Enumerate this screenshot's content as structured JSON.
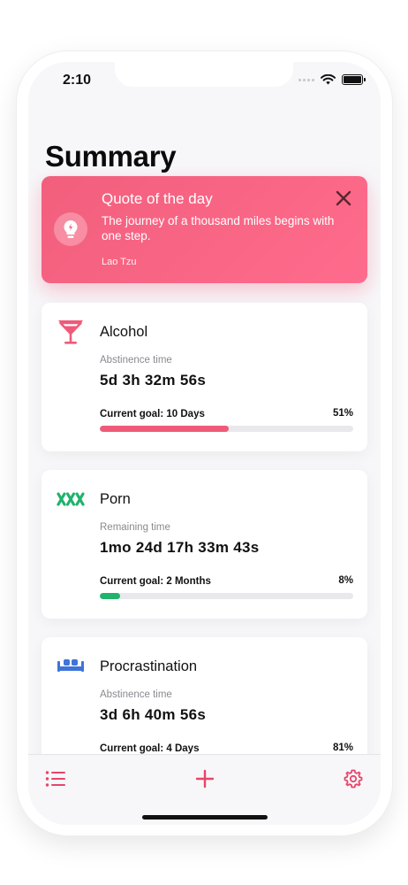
{
  "status_bar": {
    "time": "2:10"
  },
  "page": {
    "title": "Summary"
  },
  "quote": {
    "title": "Quote of the day",
    "text": "The journey of a thousand miles begins with one step.",
    "author": "Lao Tzu",
    "icon": "lightbulb-icon",
    "close_icon": "close-icon"
  },
  "habits": [
    {
      "name": "Alcohol",
      "icon": "cocktail-glass-icon",
      "color": "#ef5a79",
      "time_label": "Abstinence time",
      "time_value": "5d 3h 32m 56s",
      "goal": "Current goal: 10 Days",
      "percent_label": "51%",
      "progress": 0.51
    },
    {
      "name": "Porn",
      "icon": "xxx-icon",
      "color": "#1fb36b",
      "time_label": "Remaining time",
      "time_value": "1mo 24d 17h 33m 43s",
      "goal": "Current goal: 2 Months",
      "percent_label": "8%",
      "progress": 0.08
    },
    {
      "name": "Procrastination",
      "icon": "couch-icon",
      "color": "#3f74d8",
      "time_label": "Abstinence time",
      "time_value": "3d 6h 40m 56s",
      "goal": "Current goal: 4 Days",
      "percent_label": "81%",
      "progress": 0.81
    }
  ],
  "tab_bar": {
    "accent": "#e8456a",
    "items": [
      "list-icon",
      "add-icon",
      "settings-icon"
    ]
  }
}
